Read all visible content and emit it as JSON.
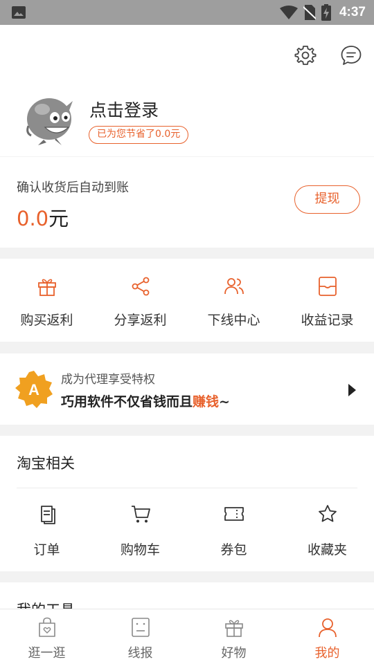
{
  "status_bar": {
    "time": "4:37"
  },
  "header": {
    "login_text": "点击登录",
    "saved_badge": "已为您节省了0.0元"
  },
  "balance": {
    "label": "确认收货后自动到账",
    "amount": "0.0",
    "unit": "元",
    "withdraw_label": "提现"
  },
  "rebate_menu": [
    {
      "label": "购买返利",
      "icon": "gift-icon"
    },
    {
      "label": "分享返利",
      "icon": "share-icon"
    },
    {
      "label": "下线中心",
      "icon": "users-icon"
    },
    {
      "label": "收益记录",
      "icon": "wallet-icon"
    }
  ],
  "agent_banner": {
    "badge_letter": "A",
    "subtitle": "成为代理享受特权",
    "main_prefix": "巧用软件不仅省钱而且",
    "main_highlight": "赚钱",
    "main_suffix": "~"
  },
  "taobao": {
    "title": "淘宝相关",
    "items": [
      {
        "label": "订单",
        "icon": "order-icon"
      },
      {
        "label": "购物车",
        "icon": "cart-icon"
      },
      {
        "label": "券包",
        "icon": "coupon-icon"
      },
      {
        "label": "收藏夹",
        "icon": "star-icon"
      }
    ]
  },
  "tools": {
    "title": "我的工具"
  },
  "tabbar": [
    {
      "label": "逛一逛",
      "icon": "shopping-bag-icon",
      "active": false
    },
    {
      "label": "线报",
      "icon": "news-icon",
      "active": false
    },
    {
      "label": "好物",
      "icon": "gift-icon",
      "active": false
    },
    {
      "label": "我的",
      "icon": "person-icon",
      "active": true
    }
  ],
  "colors": {
    "accent": "#e8612c",
    "status_bar": "#9e9e9e",
    "background": "#f2f2f2"
  }
}
